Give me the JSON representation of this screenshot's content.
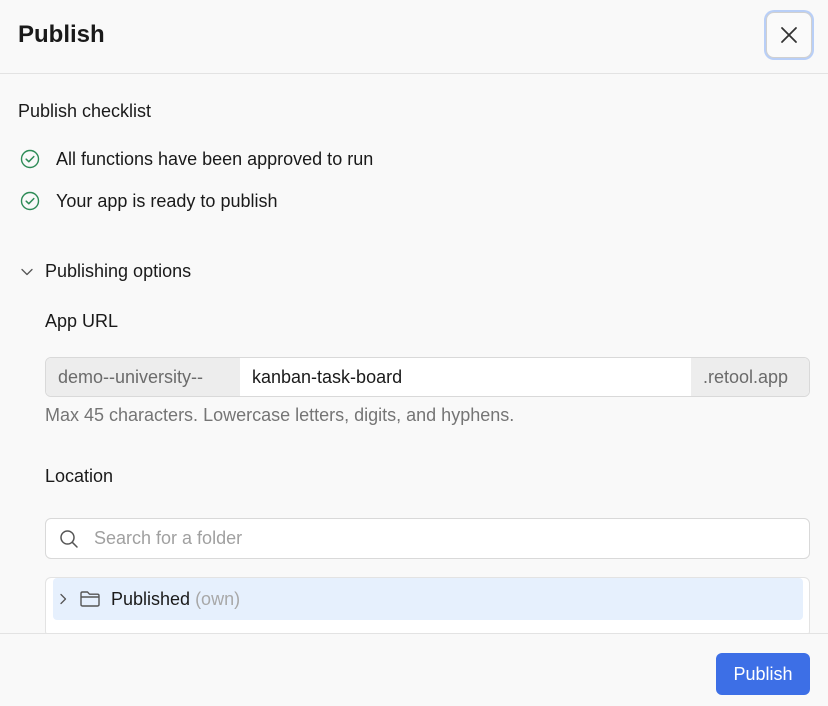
{
  "header": {
    "title": "Publish",
    "close_icon": "close-icon"
  },
  "checklist": {
    "title": "Publish checklist",
    "items": [
      {
        "label": "All functions have been approved to run",
        "icon": "check-circle-icon",
        "status_color": "#2e8b57"
      },
      {
        "label": "Your app is ready to publish",
        "icon": "check-circle-icon",
        "status_color": "#2e8b57"
      }
    ]
  },
  "options": {
    "toggle_label": "Publishing options",
    "expanded": true,
    "app_url": {
      "label": "App URL",
      "prefix": "demo--university--",
      "value": "kanban-task-board",
      "suffix": ".retool.app",
      "hint": "Max 45 characters. Lowercase letters, digits, and hyphens."
    },
    "location": {
      "label": "Location",
      "search_placeholder": "Search for a folder",
      "folders": [
        {
          "name": "Published",
          "meta": "(own)",
          "selected": true
        }
      ]
    }
  },
  "footer": {
    "publish_label": "Publish"
  },
  "colors": {
    "accent": "#3d6fe6",
    "selected_row": "#e6f0fd",
    "success": "#2e8b57"
  }
}
